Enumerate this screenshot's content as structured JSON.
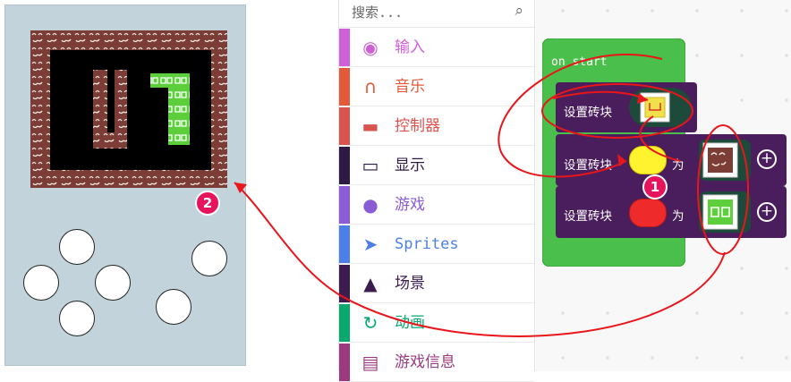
{
  "search": {
    "placeholder": "搜索..."
  },
  "toolbox": {
    "categories": [
      {
        "label": "输入",
        "color": "#d060d6",
        "icon": "target-icon"
      },
      {
        "label": "音乐",
        "color": "#e35a3a",
        "icon": "headphones-icon"
      },
      {
        "label": "控制器",
        "color": "#d9534f",
        "icon": "gamepad-icon"
      },
      {
        "label": "显示",
        "color": "#2e1b45",
        "icon": "monitor-icon"
      },
      {
        "label": "游戏",
        "color": "#8a5cd6",
        "icon": "circle-icon"
      },
      {
        "label": "Sprites",
        "color": "#4d7fe8",
        "icon": "paper-plane-icon"
      },
      {
        "label": "场景",
        "color": "#3c1c4f",
        "icon": "tree-icon"
      },
      {
        "label": "动画",
        "color": "#09a86f",
        "icon": "refresh-icon"
      },
      {
        "label": "游戏信息",
        "color": "#9b3a80",
        "icon": "id-card-icon"
      }
    ]
  },
  "blocks": {
    "hat_label": "on start",
    "set_tile_label": "设置砖块",
    "as_label": "为"
  },
  "annotations": {
    "marker_1": "1",
    "marker_2": "2"
  },
  "colors": {
    "hat": "#4bbf4b",
    "scene_block": "#4a1d5c",
    "brick": "#7b3d36",
    "annotation": "#e8161b",
    "marker": "#e5145d"
  }
}
